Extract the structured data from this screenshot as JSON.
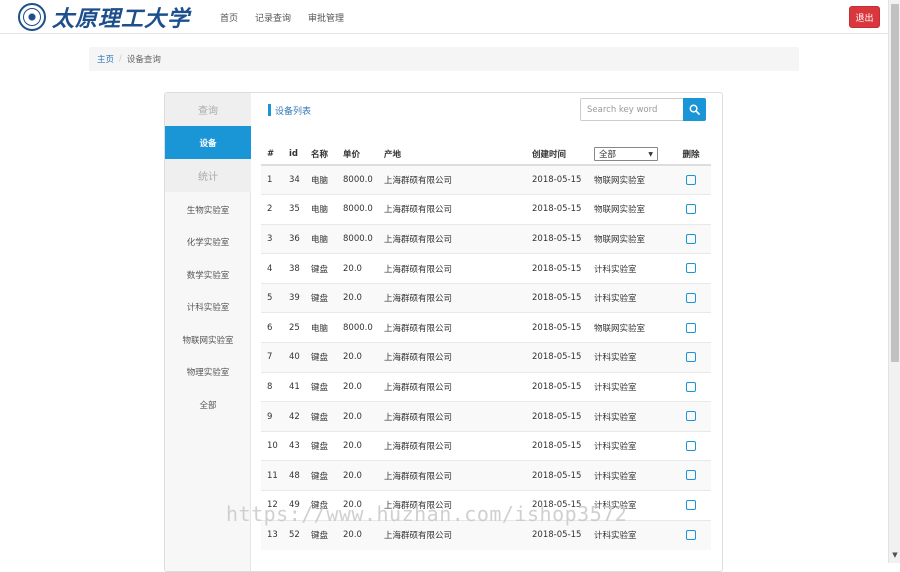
{
  "header": {
    "logo_text": "太原理工大学",
    "nav": [
      "首页",
      "记录查询",
      "审批管理"
    ],
    "logout_label": "退出"
  },
  "breadcrumb": {
    "home": "主页",
    "separator": "/",
    "current": "设备查询"
  },
  "sidebar": {
    "query_header": "查询",
    "active_item": "设备",
    "stats_header": "统计",
    "items": [
      "生物实验室",
      "化学实验室",
      "数学实验室",
      "计科实验室",
      "物联网实验室",
      "物理实验室",
      "全部"
    ]
  },
  "list": {
    "title": "设备列表",
    "search_placeholder": "Search key word",
    "columns": [
      "#",
      "id",
      "名称",
      "单价",
      "产地",
      "创建时间",
      "全部",
      "删除"
    ],
    "filter_arrow": "▼"
  },
  "rows": [
    [
      "1",
      "34",
      "电脑",
      "8000.0",
      "上海群硕有限公司",
      "2018-05-15",
      "物联网实验室"
    ],
    [
      "2",
      "35",
      "电脑",
      "8000.0",
      "上海群硕有限公司",
      "2018-05-15",
      "物联网实验室"
    ],
    [
      "3",
      "36",
      "电脑",
      "8000.0",
      "上海群硕有限公司",
      "2018-05-15",
      "物联网实验室"
    ],
    [
      "4",
      "38",
      "键盘",
      "20.0",
      "上海群硕有限公司",
      "2018-05-15",
      "计科实验室"
    ],
    [
      "5",
      "39",
      "键盘",
      "20.0",
      "上海群硕有限公司",
      "2018-05-15",
      "计科实验室"
    ],
    [
      "6",
      "25",
      "电脑",
      "8000.0",
      "上海群硕有限公司",
      "2018-05-15",
      "物联网实验室"
    ],
    [
      "7",
      "40",
      "键盘",
      "20.0",
      "上海群硕有限公司",
      "2018-05-15",
      "计科实验室"
    ],
    [
      "8",
      "41",
      "键盘",
      "20.0",
      "上海群硕有限公司",
      "2018-05-15",
      "计科实验室"
    ],
    [
      "9",
      "42",
      "键盘",
      "20.0",
      "上海群硕有限公司",
      "2018-05-15",
      "计科实验室"
    ],
    [
      "10",
      "43",
      "键盘",
      "20.0",
      "上海群硕有限公司",
      "2018-05-15",
      "计科实验室"
    ],
    [
      "11",
      "48",
      "键盘",
      "20.0",
      "上海群硕有限公司",
      "2018-05-15",
      "计科实验室"
    ],
    [
      "12",
      "49",
      "键盘",
      "20.0",
      "上海群硕有限公司",
      "2018-05-15",
      "计科实验室"
    ],
    [
      "13",
      "52",
      "键盘",
      "20.0",
      "上海群硕有限公司",
      "2018-05-15",
      "计科实验室"
    ]
  ],
  "watermark": "https://www.huzhan.com/ishop3572",
  "colors": {
    "accent": "#1a95d6",
    "logout": "#d9363e",
    "brand": "#1c4f8c"
  }
}
